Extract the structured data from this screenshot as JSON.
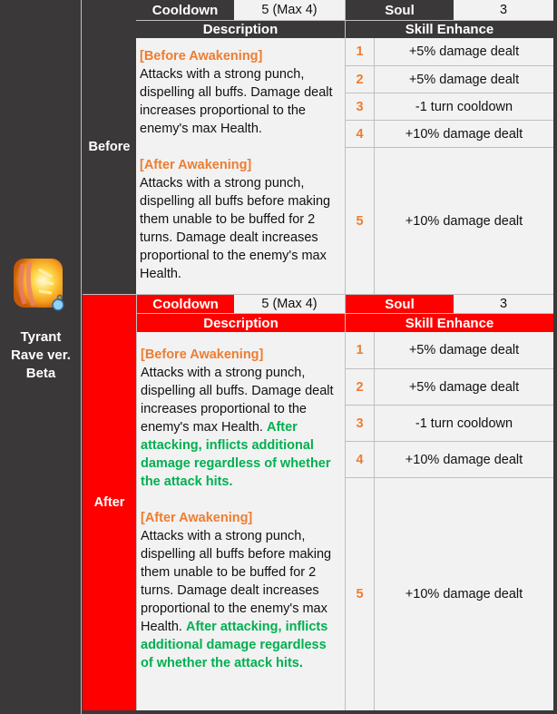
{
  "skill": {
    "name": "Tyrant Rave ver. Beta",
    "name_lines": [
      "Tyrant",
      "Rave ver.",
      "Beta"
    ],
    "icon": "skill-fist-fire-icon"
  },
  "colors": {
    "before_header": "#3a3838",
    "after_header": "#ff0000",
    "awakening_tag": "#ed7d31",
    "new_text": "#00b050",
    "cell_bg": "#f2f2f2"
  },
  "labels": {
    "cooldown": "Cooldown",
    "soul": "Soul",
    "description": "Description",
    "skill_enhance": "Skill Enhance"
  },
  "before": {
    "label": "Before",
    "cooldown": "5 (Max 4)",
    "soul": "3",
    "pre_awakening_tag": "[Before Awakening]",
    "pre_awakening_text": "Attacks with a strong punch, dispelling all buffs. Damage dealt increases proportional to the enemy's max Health.",
    "post_awakening_tag": "[After Awakening]",
    "post_awakening_text": "Attacks with a strong punch, dispelling all buffs before making them unable to be buffed for 2 turns. Damage dealt increases proportional to the enemy's max Health.",
    "enhance": [
      {
        "level": "1",
        "effect": "+5% damage dealt"
      },
      {
        "level": "2",
        "effect": "+5% damage dealt"
      },
      {
        "level": "3",
        "effect": "-1 turn cooldown"
      },
      {
        "level": "4",
        "effect": "+10% damage dealt"
      },
      {
        "level": "5",
        "effect": "+10% damage dealt"
      }
    ]
  },
  "after": {
    "label": "After",
    "cooldown": "5 (Max 4)",
    "soul": "3",
    "pre_awakening_tag": "[Before Awakening]",
    "pre_awakening_text": "Attacks with a strong punch, dispelling all buffs. Damage dealt increases proportional to the enemy's max Health.",
    "pre_awakening_added": "After attacking, inflicts additional damage regardless of whether the attack hits.",
    "post_awakening_tag": "[After Awakening]",
    "post_awakening_text": "Attacks with a strong punch, dispelling all buffs before making them unable to be buffed for 2 turns. Damage dealt increases proportional to the enemy's max Health.",
    "post_awakening_added": "After attacking, inflicts additional damage regardless of whether the attack hits.",
    "enhance": [
      {
        "level": "1",
        "effect": "+5% damage dealt"
      },
      {
        "level": "2",
        "effect": "+5% damage dealt"
      },
      {
        "level": "3",
        "effect": "-1 turn cooldown"
      },
      {
        "level": "4",
        "effect": "+10% damage dealt"
      },
      {
        "level": "5",
        "effect": "+10% damage dealt"
      }
    ]
  }
}
